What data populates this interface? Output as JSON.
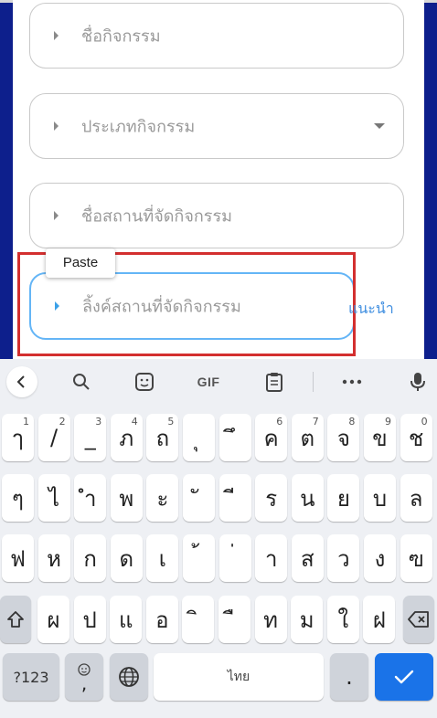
{
  "form": {
    "fields": [
      {
        "placeholder": "ชื่อกิจกรรม"
      },
      {
        "placeholder": "ประเภทกิจกรรม"
      },
      {
        "placeholder": "ชื่อสถานที่จัดกิจกรรม"
      },
      {
        "placeholder": "ลิ้งค์สถานที่จัดกิจกรรม"
      }
    ],
    "suggest_label": "แนะนำ",
    "paste_label": "Paste"
  },
  "keyboard": {
    "toolbar": {
      "gif_label": "GIF",
      "icons": [
        "back-icon",
        "search-icon",
        "sticker-icon",
        "gif-icon",
        "clipboard-icon",
        "more-icon",
        "mic-icon"
      ]
    },
    "row1": [
      {
        "char": "ๅ",
        "num": "1"
      },
      {
        "char": "/",
        "num": "2"
      },
      {
        "char": "_",
        "num": "3"
      },
      {
        "char": "ภ",
        "num": "4"
      },
      {
        "char": "ถ",
        "num": "5"
      },
      {
        "char": "ุ",
        "num": ""
      },
      {
        "char": "ึ",
        "num": ""
      },
      {
        "char": "ค",
        "num": "6"
      },
      {
        "char": "ต",
        "num": "7"
      },
      {
        "char": "จ",
        "num": "8"
      },
      {
        "char": "ข",
        "num": "9"
      },
      {
        "char": "ช",
        "num": "0"
      }
    ],
    "row2": [
      "ๆ",
      "ไ",
      "ำ",
      "พ",
      "ะ",
      "ั",
      "ี",
      "ร",
      "น",
      "ย",
      "บ",
      "ล"
    ],
    "row3": [
      "ฟ",
      "ห",
      "ก",
      "ด",
      "เ",
      "้",
      "่",
      "า",
      "ส",
      "ว",
      "ง",
      "ฃ"
    ],
    "row4": [
      "ผ",
      "ป",
      "แ",
      "อ",
      "ิ",
      "ื",
      "ท",
      "ม",
      "ใ",
      "ฝ"
    ],
    "bottom": {
      "mode_label": "?123",
      "emoji_comma": ",",
      "space_label": "ไทย",
      "period": "."
    },
    "colors": {
      "accent": "#1a73e8",
      "key": "#ffffff",
      "special": "#cfd3da",
      "bg": "#eef0f4"
    }
  }
}
